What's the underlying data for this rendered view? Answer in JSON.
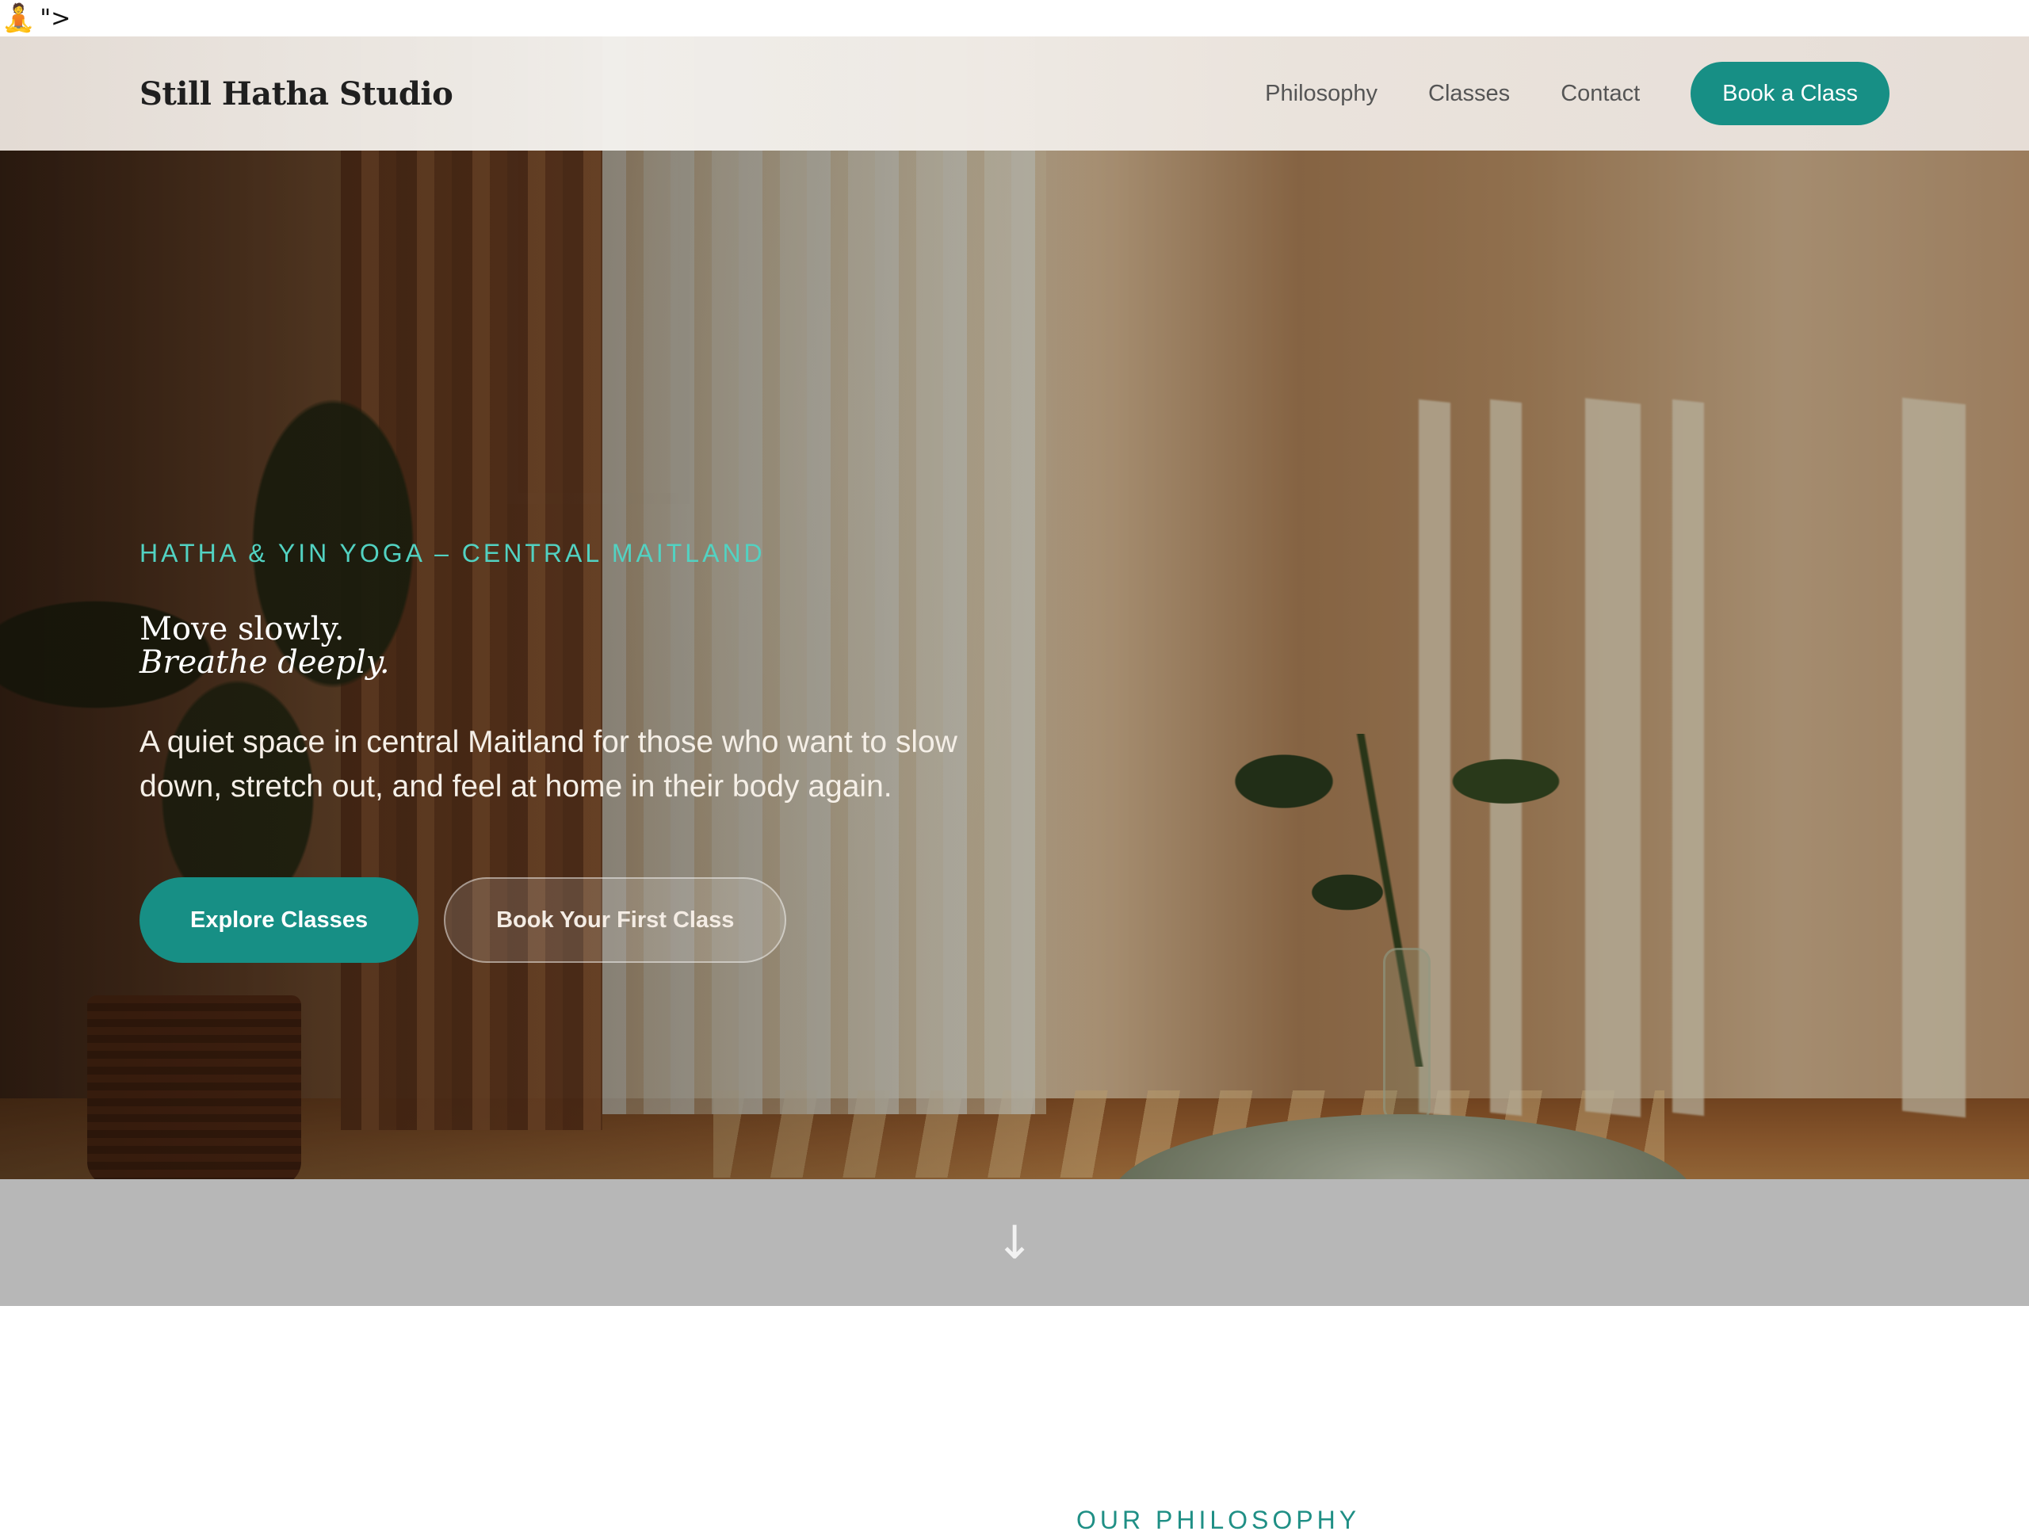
{
  "stray": {
    "glyph": "🧘",
    "text": "\">"
  },
  "header": {
    "brand": "Still Hatha Studio",
    "nav": [
      {
        "label": "Philosophy"
      },
      {
        "label": "Classes"
      },
      {
        "label": "Contact"
      }
    ],
    "cta_label": "Book a Class"
  },
  "hero": {
    "eyebrow": "Hatha & Yin Yoga – Central Maitland",
    "title_line1": "Move slowly.",
    "title_line2": "Breathe deeply.",
    "lead": "A quiet space in central Maitland for those who want to slow down, stretch out, and feel at home in their body again.",
    "primary_button": "Explore Classes",
    "secondary_button": "Book Your First Class"
  },
  "scroll_indicator": {
    "icon": "arrow-down-icon",
    "glyph": "↓"
  },
  "next_section": {
    "label": "Our Philosophy"
  },
  "colors": {
    "accent": "#178f85",
    "eyebrow": "#52d2c2",
    "band": "#b7b7b7"
  }
}
